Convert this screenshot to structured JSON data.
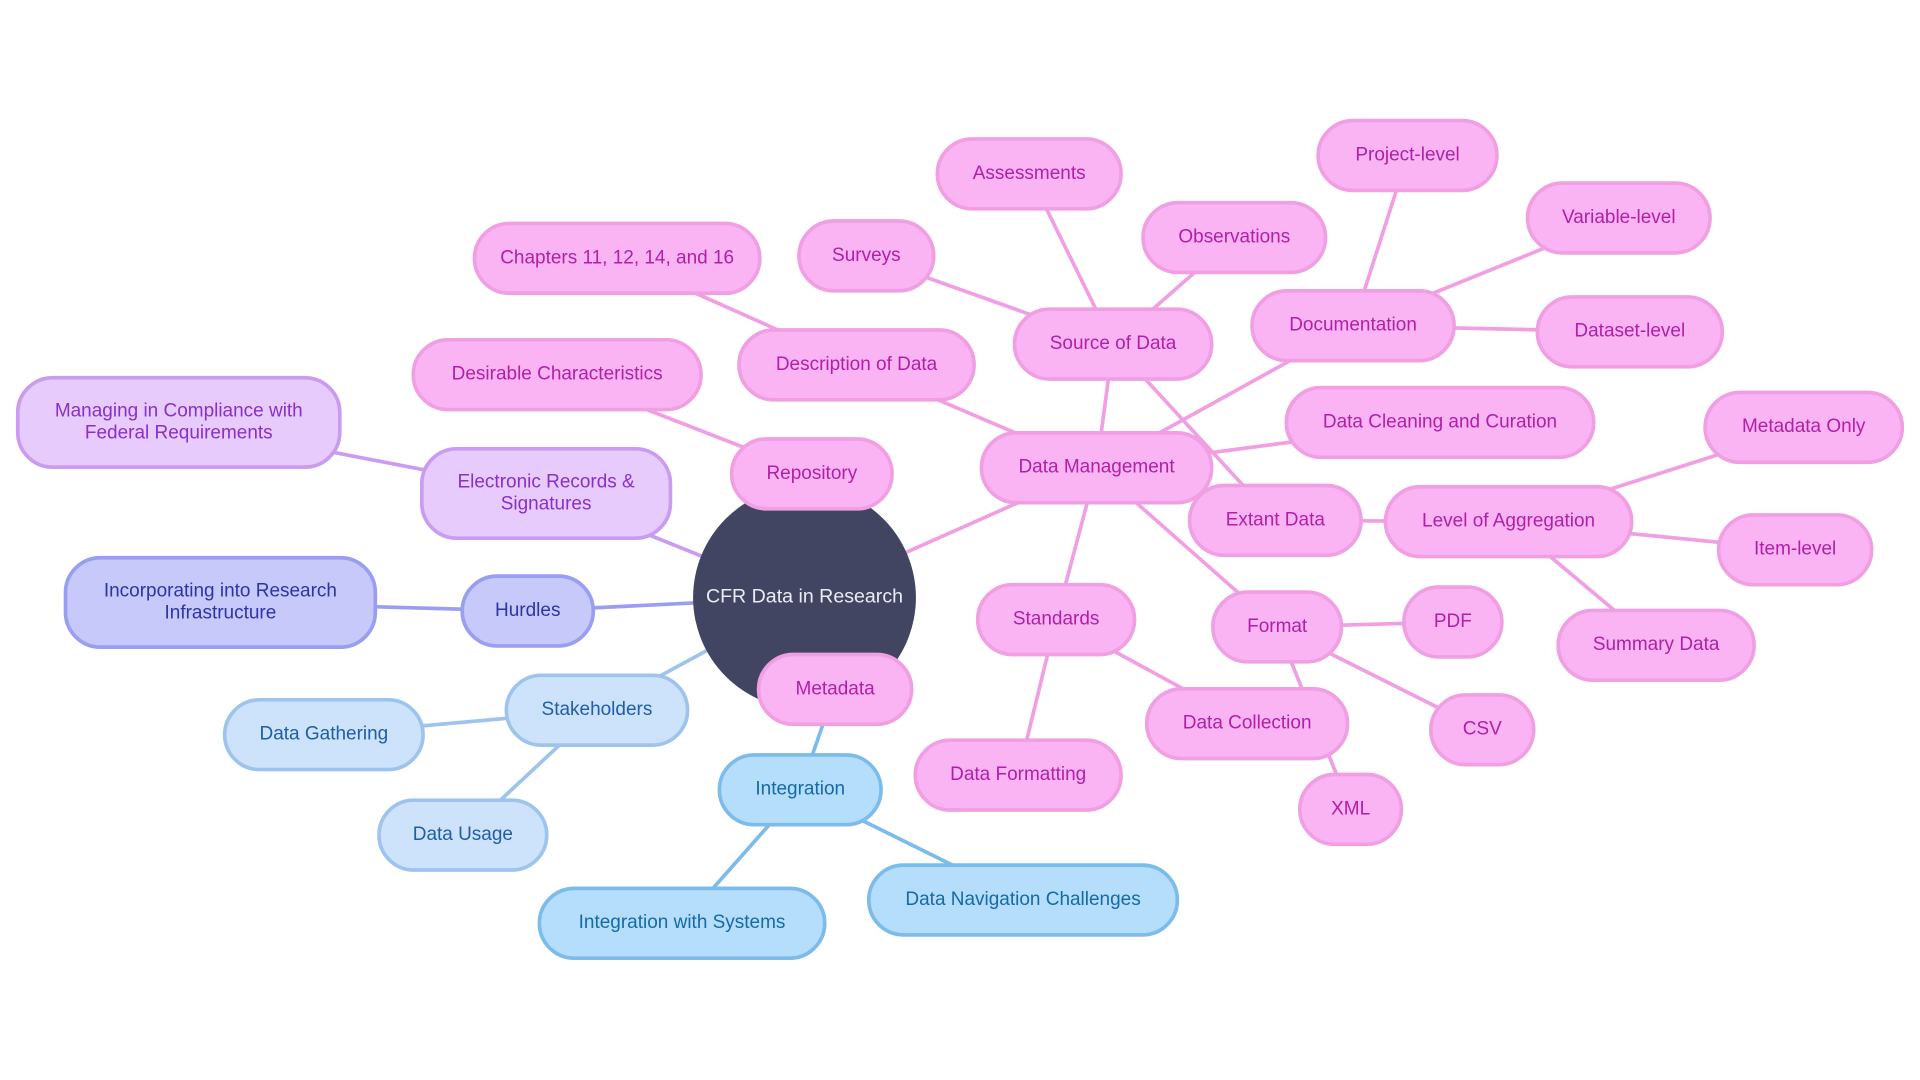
{
  "diagram": {
    "type": "mindmap",
    "root": {
      "id": "root",
      "label": "CFR Data in Research"
    },
    "colors": {
      "root": "#414561",
      "pink_fill": "#fbb4f3",
      "pink_stroke": "#f09fe2",
      "pink_text": "#b01fa6",
      "violet_fill": "#e7cbfd",
      "violet_stroke": "#c99cf0",
      "violet_text": "#8a2fc8",
      "indigo_fill": "#c7c9fb",
      "indigo_stroke": "#9a9ef0",
      "indigo_text": "#2e34a8",
      "lblue_fill": "#cde3fb",
      "lblue_stroke": "#9ec4ee",
      "lblue_text": "#1f5ea8",
      "sky_fill": "#b5defc",
      "sky_stroke": "#7cbcea",
      "sky_text": "#156aa8"
    },
    "nodes": [
      {
        "id": "root",
        "label": "CFR Data in Research",
        "theme": "root"
      },
      {
        "id": "electronic",
        "label": "Electronic Records &\nSignatures",
        "theme": "violet",
        "parent": "root"
      },
      {
        "id": "managing",
        "label": "Managing in Compliance with\nFederal Requirements",
        "theme": "violet",
        "parent": "electronic"
      },
      {
        "id": "hurdles",
        "label": "Hurdles",
        "theme": "indigo",
        "parent": "root"
      },
      {
        "id": "incorporating",
        "label": "Incorporating into Research\nInfrastructure",
        "theme": "indigo",
        "parent": "hurdles"
      },
      {
        "id": "stakeholders",
        "label": "Stakeholders",
        "theme": "lblue",
        "parent": "root"
      },
      {
        "id": "gathering",
        "label": "Data Gathering",
        "theme": "lblue",
        "parent": "stakeholders"
      },
      {
        "id": "usage",
        "label": "Data Usage",
        "theme": "lblue",
        "parent": "stakeholders"
      },
      {
        "id": "metadata",
        "label": "Metadata",
        "theme": "pink",
        "parent": "root"
      },
      {
        "id": "integration",
        "label": "Integration",
        "theme": "sky",
        "parent": "metadata"
      },
      {
        "id": "intsystems",
        "label": "Integration with Systems",
        "theme": "sky",
        "parent": "integration"
      },
      {
        "id": "navchallenges",
        "label": "Data Navigation Challenges",
        "theme": "sky",
        "parent": "integration"
      },
      {
        "id": "repository",
        "label": "Repository",
        "theme": "pink",
        "parent": "root"
      },
      {
        "id": "desirable",
        "label": "Desirable Characteristics",
        "theme": "pink",
        "parent": "repository"
      },
      {
        "id": "datamgmt",
        "label": "Data Management",
        "theme": "pink",
        "parent": "root"
      },
      {
        "id": "description",
        "label": "Description of Data",
        "theme": "pink",
        "parent": "datamgmt"
      },
      {
        "id": "chapters",
        "label": "Chapters 11, 12, 14, and 16",
        "theme": "pink",
        "parent": "description"
      },
      {
        "id": "source",
        "label": "Source of Data",
        "theme": "pink",
        "parent": "datamgmt"
      },
      {
        "id": "surveys",
        "label": "Surveys",
        "theme": "pink",
        "parent": "source"
      },
      {
        "id": "assessments",
        "label": "Assessments",
        "theme": "pink",
        "parent": "source"
      },
      {
        "id": "observations",
        "label": "Observations",
        "theme": "pink",
        "parent": "source"
      },
      {
        "id": "extant",
        "label": "Extant Data",
        "theme": "pink",
        "parent": "source"
      },
      {
        "id": "documentation",
        "label": "Documentation",
        "theme": "pink",
        "parent": "datamgmt"
      },
      {
        "id": "project",
        "label": "Project-level",
        "theme": "pink",
        "parent": "documentation"
      },
      {
        "id": "variable",
        "label": "Variable-level",
        "theme": "pink",
        "parent": "documentation"
      },
      {
        "id": "dataset",
        "label": "Dataset-level",
        "theme": "pink",
        "parent": "documentation"
      },
      {
        "id": "cleaning",
        "label": "Data Cleaning and Curation",
        "theme": "pink",
        "parent": "datamgmt"
      },
      {
        "id": "aggregation",
        "label": "Level of Aggregation",
        "theme": "pink",
        "parent": "extant"
      },
      {
        "id": "metaonly",
        "label": "Metadata Only",
        "theme": "pink",
        "parent": "aggregation"
      },
      {
        "id": "itemlevel",
        "label": "Item-level",
        "theme": "pink",
        "parent": "aggregation"
      },
      {
        "id": "summary",
        "label": "Summary Data",
        "theme": "pink",
        "parent": "aggregation"
      },
      {
        "id": "standards",
        "label": "Standards",
        "theme": "pink",
        "parent": "datamgmt"
      },
      {
        "id": "formatting",
        "label": "Data Formatting",
        "theme": "pink",
        "parent": "standards"
      },
      {
        "id": "collection",
        "label": "Data Collection",
        "theme": "pink",
        "parent": "standards"
      },
      {
        "id": "format",
        "label": "Format",
        "theme": "pink",
        "parent": "datamgmt"
      },
      {
        "id": "pdf",
        "label": "PDF",
        "theme": "pink",
        "parent": "format"
      },
      {
        "id": "csv",
        "label": "CSV",
        "theme": "pink",
        "parent": "format"
      },
      {
        "id": "xml",
        "label": "XML",
        "theme": "pink",
        "parent": "format"
      }
    ]
  }
}
